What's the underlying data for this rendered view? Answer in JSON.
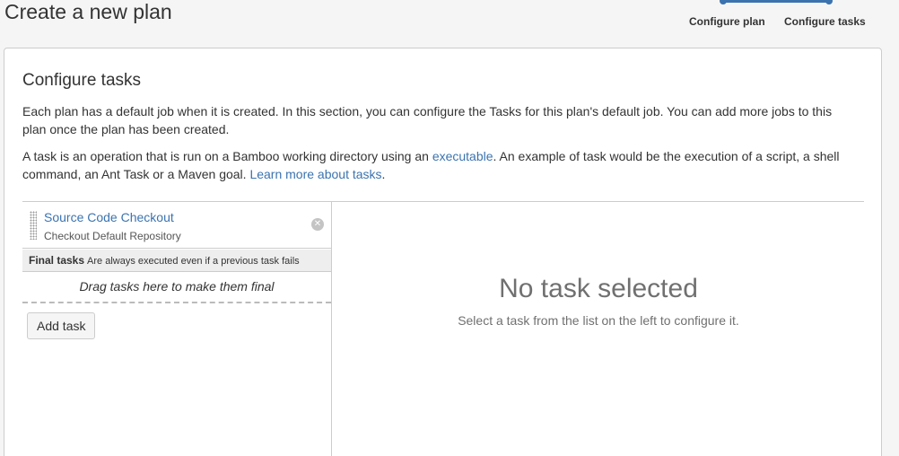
{
  "page": {
    "title": "Create a new plan"
  },
  "tracker": {
    "steps": [
      {
        "label": "Configure plan"
      },
      {
        "label": "Configure tasks"
      }
    ],
    "accent": "#3b73af"
  },
  "section": {
    "title": "Configure tasks",
    "paragraph1": "Each plan has a default job when it is created. In this section, you can configure the Tasks for this plan's default job. You can add more jobs to this plan once the plan has been created.",
    "paragraph2_before": "A task is an operation that is run on a Bamboo working directory using an ",
    "paragraph2_link": "executable",
    "paragraph2_middle": ". An example of task would be the execution of a script, a shell command, an Ant Task or a Maven goal. ",
    "paragraph2_link2": "Learn more about tasks",
    "paragraph2_after": "."
  },
  "tasks": {
    "items": [
      {
        "name": "Source Code Checkout",
        "description": "Checkout Default Repository",
        "remove_icon": "close-circle-icon"
      }
    ],
    "final_header": {
      "title": "Final tasks",
      "subtitle": "Are always executed even if a previous task fails"
    },
    "drop_hint": "Drag tasks here to make them final",
    "add_label": "Add task"
  },
  "details": {
    "empty_title": "No task selected",
    "empty_hint": "Select a task from the list on the left to configure it."
  },
  "colors": {
    "link": "#3b73af",
    "muted": "#707070",
    "border": "#cccccc"
  }
}
